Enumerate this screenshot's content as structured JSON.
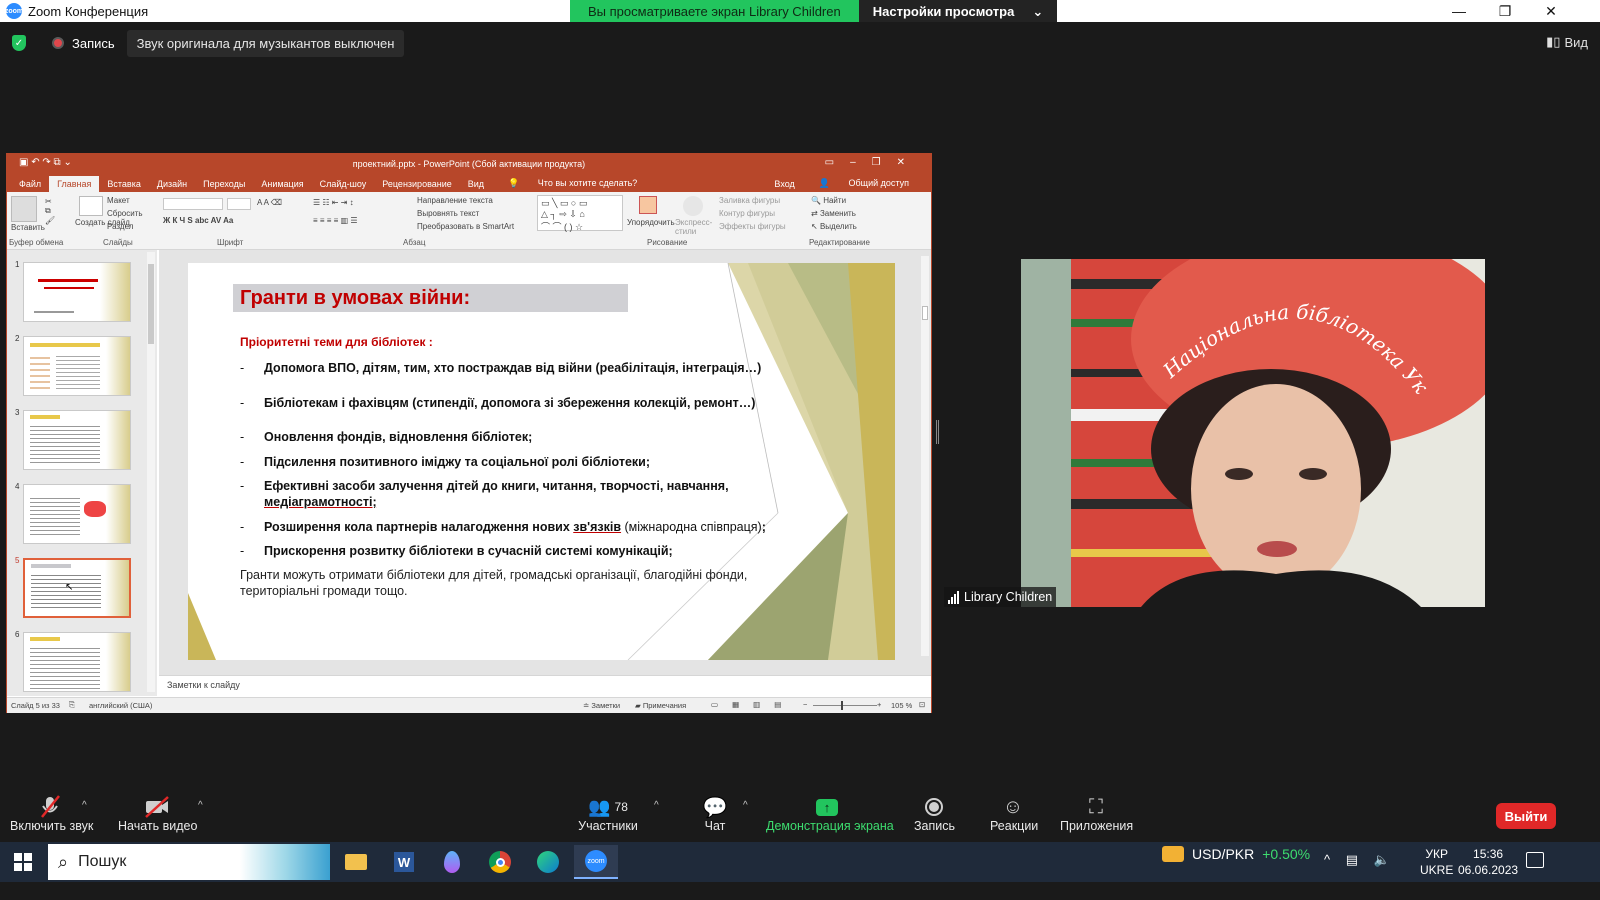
{
  "window": {
    "title": "Zoom Конференция",
    "zoom_icon_text": "zoom"
  },
  "share_bar": {
    "viewing": "Вы просматриваете экран Library Children",
    "settings": "Настройки просмотра"
  },
  "status": {
    "record": "Запись",
    "notice": "Звук оригинала для музыкантов выключен",
    "view": "Вид"
  },
  "ppt": {
    "title": "проектний.pptx - PowerPoint (Сбой активации продукта)",
    "tabs": [
      "Файл",
      "Главная",
      "Вставка",
      "Дизайн",
      "Переходы",
      "Анимация",
      "Слайд-шоу",
      "Рецензирование",
      "Вид"
    ],
    "tell_me": "Что вы хотите сделать?",
    "signin": "Вход",
    "share": "Общий доступ",
    "ribbon": {
      "paste": "Вставить",
      "clipboard": "Буфер обмена",
      "layout": "Макет",
      "reset": "Сбросить",
      "new_slide": "Создать слайд",
      "section": "Раздел",
      "slides": "Слайды",
      "font": "Шрифт",
      "paragraph": "Абзац",
      "text_direction": "Направление текста",
      "align_text": "Выровнять текст",
      "smartart": "Преобразовать в SmartArt",
      "arrange": "Упорядочить",
      "quick_styles": "Экспресс-стили",
      "shape_fill": "Заливка фигуры",
      "shape_outline": "Контур фигуры",
      "shape_effects": "Эффекты фигуры",
      "drawing": "Рисование",
      "find": "Найти",
      "replace": "Заменить",
      "select": "Выделить",
      "editing": "Редактирование"
    },
    "thumb_numbers": [
      "1",
      "2",
      "3",
      "4",
      "5",
      "6"
    ],
    "slide": {
      "title": "Гранти в умовах війни:",
      "subtitle": "Пріоритетні теми для бібліотек :",
      "bullets": [
        "Допомога ВПО, дітям, тим, хто постраждав від війни (реабілітація, інтеграція…)",
        "Бібліотекам і фахівцям (стипендії, допомога зі збереження колекцій, ремонт…)",
        "Оновлення фондів, відновлення бібліотек;",
        "Підсилення позитивного іміджу та соціальної ролі бібліотеки;",
        "Ефективні засоби залучення дітей до  книги, читання, творчості, навчання,",
        "медіаграмотності;",
        "Розширення  кола партнерів налагодження нових ",
        "зв'язків",
        " (міжнародна співпраця)",
        ";",
        "Прискорення розвитку бібліотеки  в сучасній системі комунікацій;"
      ],
      "footer_1": "Гранти можуть отримати бібліотеки для дітей, громадські організації, благодійні фонди,",
      "footer_2": "територіальні громади тощо."
    },
    "notes_placeholder": "Заметки к слайду",
    "status": {
      "slide": "Слайд 5 из 33",
      "lang": "английский (США)",
      "notes": "Заметки",
      "comments": "Примечания",
      "zoom": "105 %"
    }
  },
  "video": {
    "name": "Library Children",
    "hat_text": "Національна бібліотека України"
  },
  "toolbar": {
    "mute": "Включить звук",
    "video": "Начать видео",
    "participants": "Участники",
    "participants_count": "78",
    "chat": "Чат",
    "share": "Демонстрация экрана",
    "record": "Запись",
    "reactions": "Реакции",
    "apps": "Приложения",
    "leave": "Выйти"
  },
  "taskbar": {
    "search": "Пошук",
    "ticker": "USD/PKR",
    "ticker_change": "+0.50%",
    "lang1": "УКР",
    "lang2": "UKRE",
    "time": "15:36",
    "date": "06.06.2023",
    "word_letter": "W",
    "zoom_text": "zoom"
  },
  "colors": {
    "ppt_accent": "#b7472a",
    "share_green": "#22c55e",
    "leave_red": "#e02828",
    "slide_title": "#c00000"
  }
}
